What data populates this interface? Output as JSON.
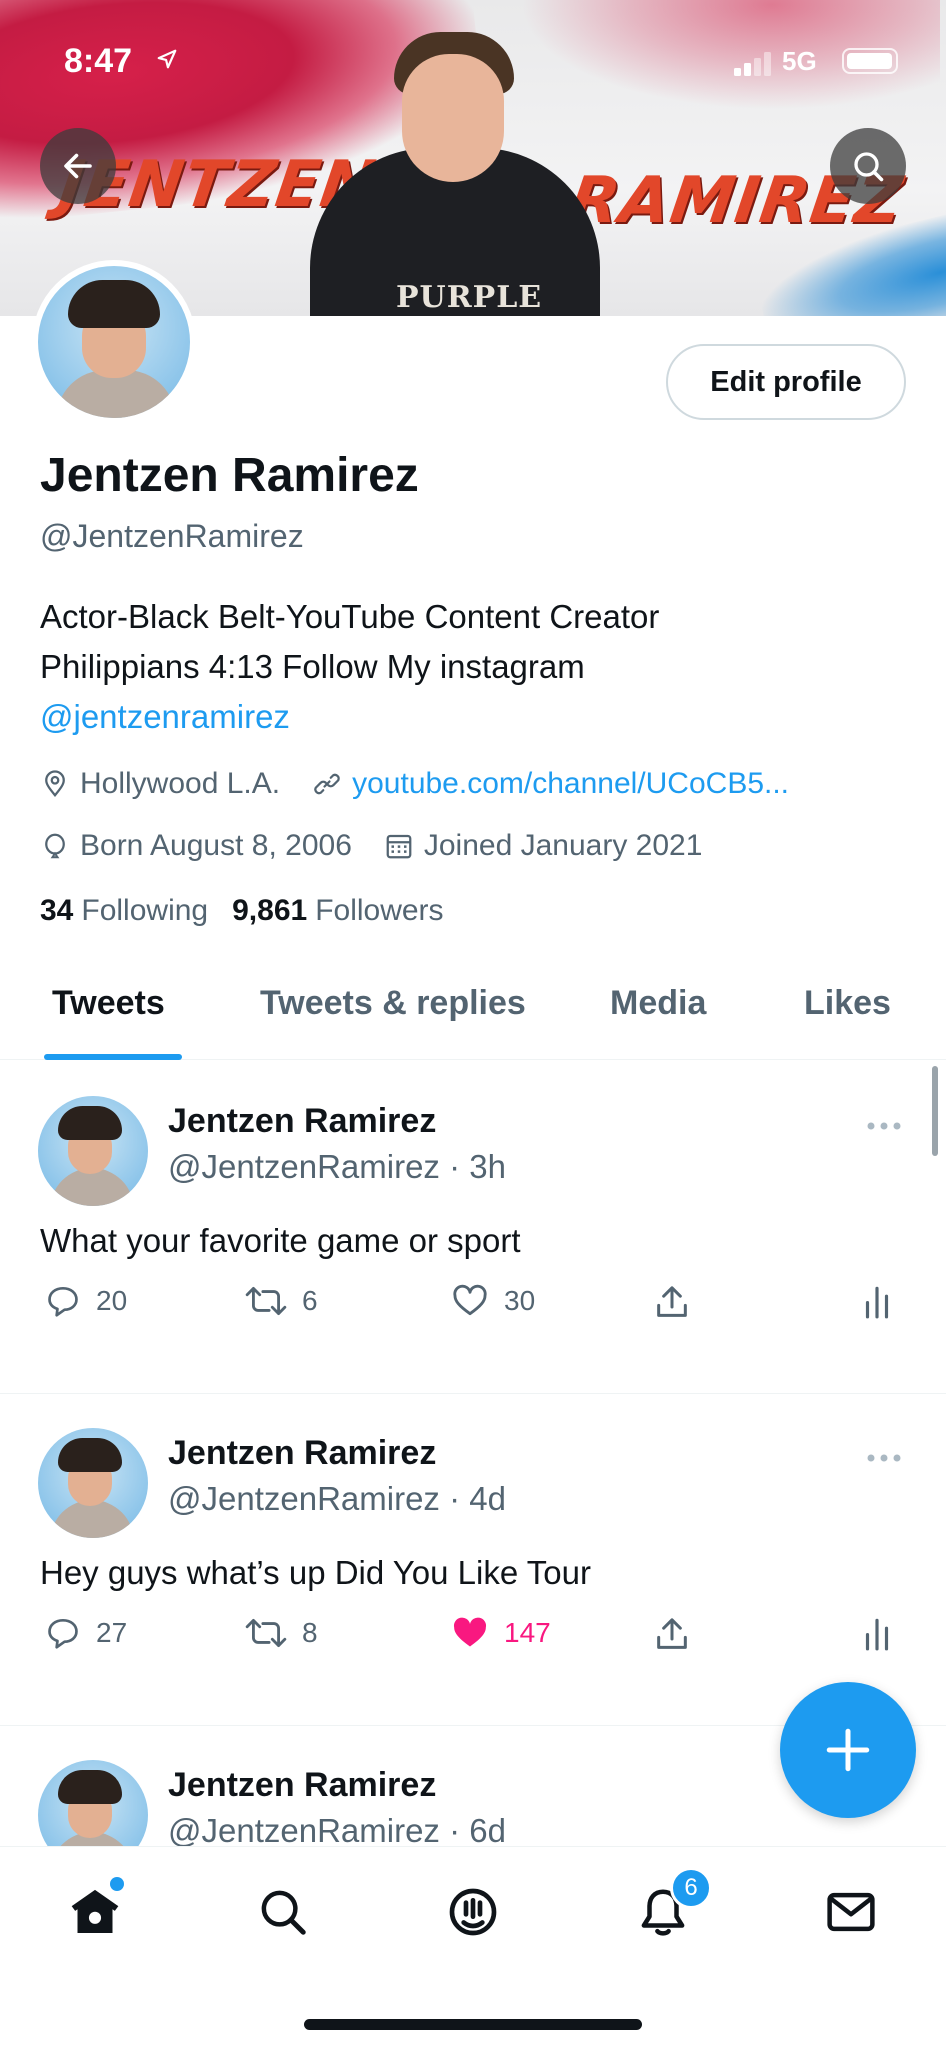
{
  "status_bar": {
    "time": "8:47",
    "network": "5G"
  },
  "banner": {
    "word_left": "JENTZEN",
    "word_right": "RAMIREZ",
    "shirt_print": "PURPLE"
  },
  "profile": {
    "edit_label": "Edit profile",
    "name": "Jentzen Ramirez",
    "handle": "@JentzenRamirez",
    "bio_line1": "Actor-Black Belt-YouTube Content Creator",
    "bio_line2": "Philippians 4:13 Follow My instagram",
    "bio_mention": "@jentzenramirez",
    "location": "Hollywood L.A.",
    "website": "youtube.com/channel/UCoCB5...",
    "birthday": "Born August 8, 2006",
    "joined": "Joined January 2021",
    "following_count": "34",
    "following_label": "Following",
    "followers_count": "9,861",
    "followers_label": "Followers"
  },
  "tabs": [
    {
      "label": "Tweets",
      "active": true
    },
    {
      "label": "Tweets & replies"
    },
    {
      "label": "Media"
    },
    {
      "label": "Likes"
    }
  ],
  "tweets": [
    {
      "name": "Jentzen Ramirez",
      "handle_time": "@JentzenRamirez · 3h",
      "text": "What your favorite game or sport",
      "replies": "20",
      "retweets": "6",
      "likes": "30",
      "liked": false
    },
    {
      "name": "Jentzen Ramirez",
      "handle_time": "@JentzenRamirez · 4d",
      "text": "Hey guys what’s up Did You Like Tour",
      "replies": "27",
      "retweets": "8",
      "likes": "147",
      "liked": true
    },
    {
      "name": "Jentzen Ramirez",
      "handle_time": "@JentzenRamirez · 6d",
      "text": ""
    }
  ],
  "nav": {
    "notifications_badge": "6"
  },
  "colors": {
    "accent": "#1d9bf0",
    "like": "#f91880",
    "text": "#0f1419",
    "secondary": "#536471"
  }
}
